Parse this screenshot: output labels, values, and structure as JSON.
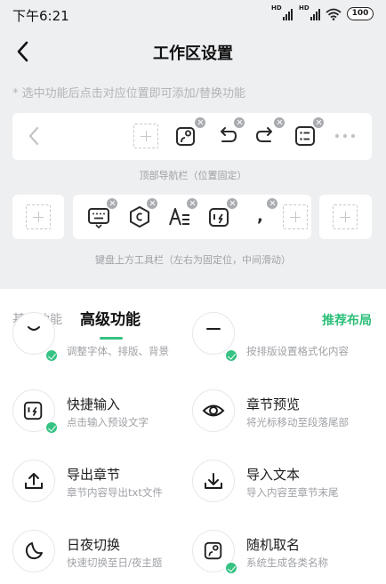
{
  "status_bar": {
    "time": "下午6:21",
    "signal_tag_1": "HD",
    "signal_tag_2": "HD",
    "battery": "100"
  },
  "header": {
    "title": "工作区设置",
    "back_icon": "chevron-left-icon"
  },
  "hint": "* 选中功能后点击对应位置即可添加/替换功能",
  "top_nav": {
    "caption": "顶部导航栏（位置固定）",
    "items": [
      "chevron-left-icon",
      "empty-slot",
      "random-name-icon",
      "undo-icon",
      "redo-icon",
      "list-icon",
      "more-icon"
    ]
  },
  "keyboard_toolbar": {
    "caption": "键盘上方工具栏（左右为固定位，中间滑动）",
    "left_fixed": "empty-slot",
    "middle_items": [
      "keyboard-icon",
      "hexagon-icon",
      "text-format-icon",
      "quick-input-icon",
      "comma-symbol",
      "empty-slot"
    ],
    "comma_text": ",",
    "right_fixed": "empty-slot"
  },
  "tabs": {
    "basic": "基础功能",
    "advanced": "高级功能",
    "recommend": "推荐布局"
  },
  "features": [
    {
      "name": "",
      "desc": "调整字体、排版、背景",
      "icon": "font-style-icon",
      "added": true
    },
    {
      "name": "",
      "desc": "按排版设置格式化内容",
      "icon": "format-icon",
      "added": true
    },
    {
      "name": "快捷输入",
      "desc": "点击输入预设文字",
      "icon": "quick-input-icon",
      "added": true
    },
    {
      "name": "章节预览",
      "desc": "将光标移动至段落尾部",
      "icon": "eye-icon",
      "added": false
    },
    {
      "name": "导出章节",
      "desc": "章节内容导出txt文件",
      "icon": "upload-icon",
      "added": false
    },
    {
      "name": "导入文本",
      "desc": "导入内容至章节末尾",
      "icon": "download-icon",
      "added": false
    },
    {
      "name": "日夜切换",
      "desc": "快速切换至日/夜主题",
      "icon": "moon-icon",
      "added": false
    },
    {
      "name": "随机取名",
      "desc": "系统生成各类名称",
      "icon": "random-name-icon",
      "added": true
    }
  ],
  "colors": {
    "accent": "#35c282",
    "background": "#eeeff1",
    "muted": "#9fa1a5"
  }
}
